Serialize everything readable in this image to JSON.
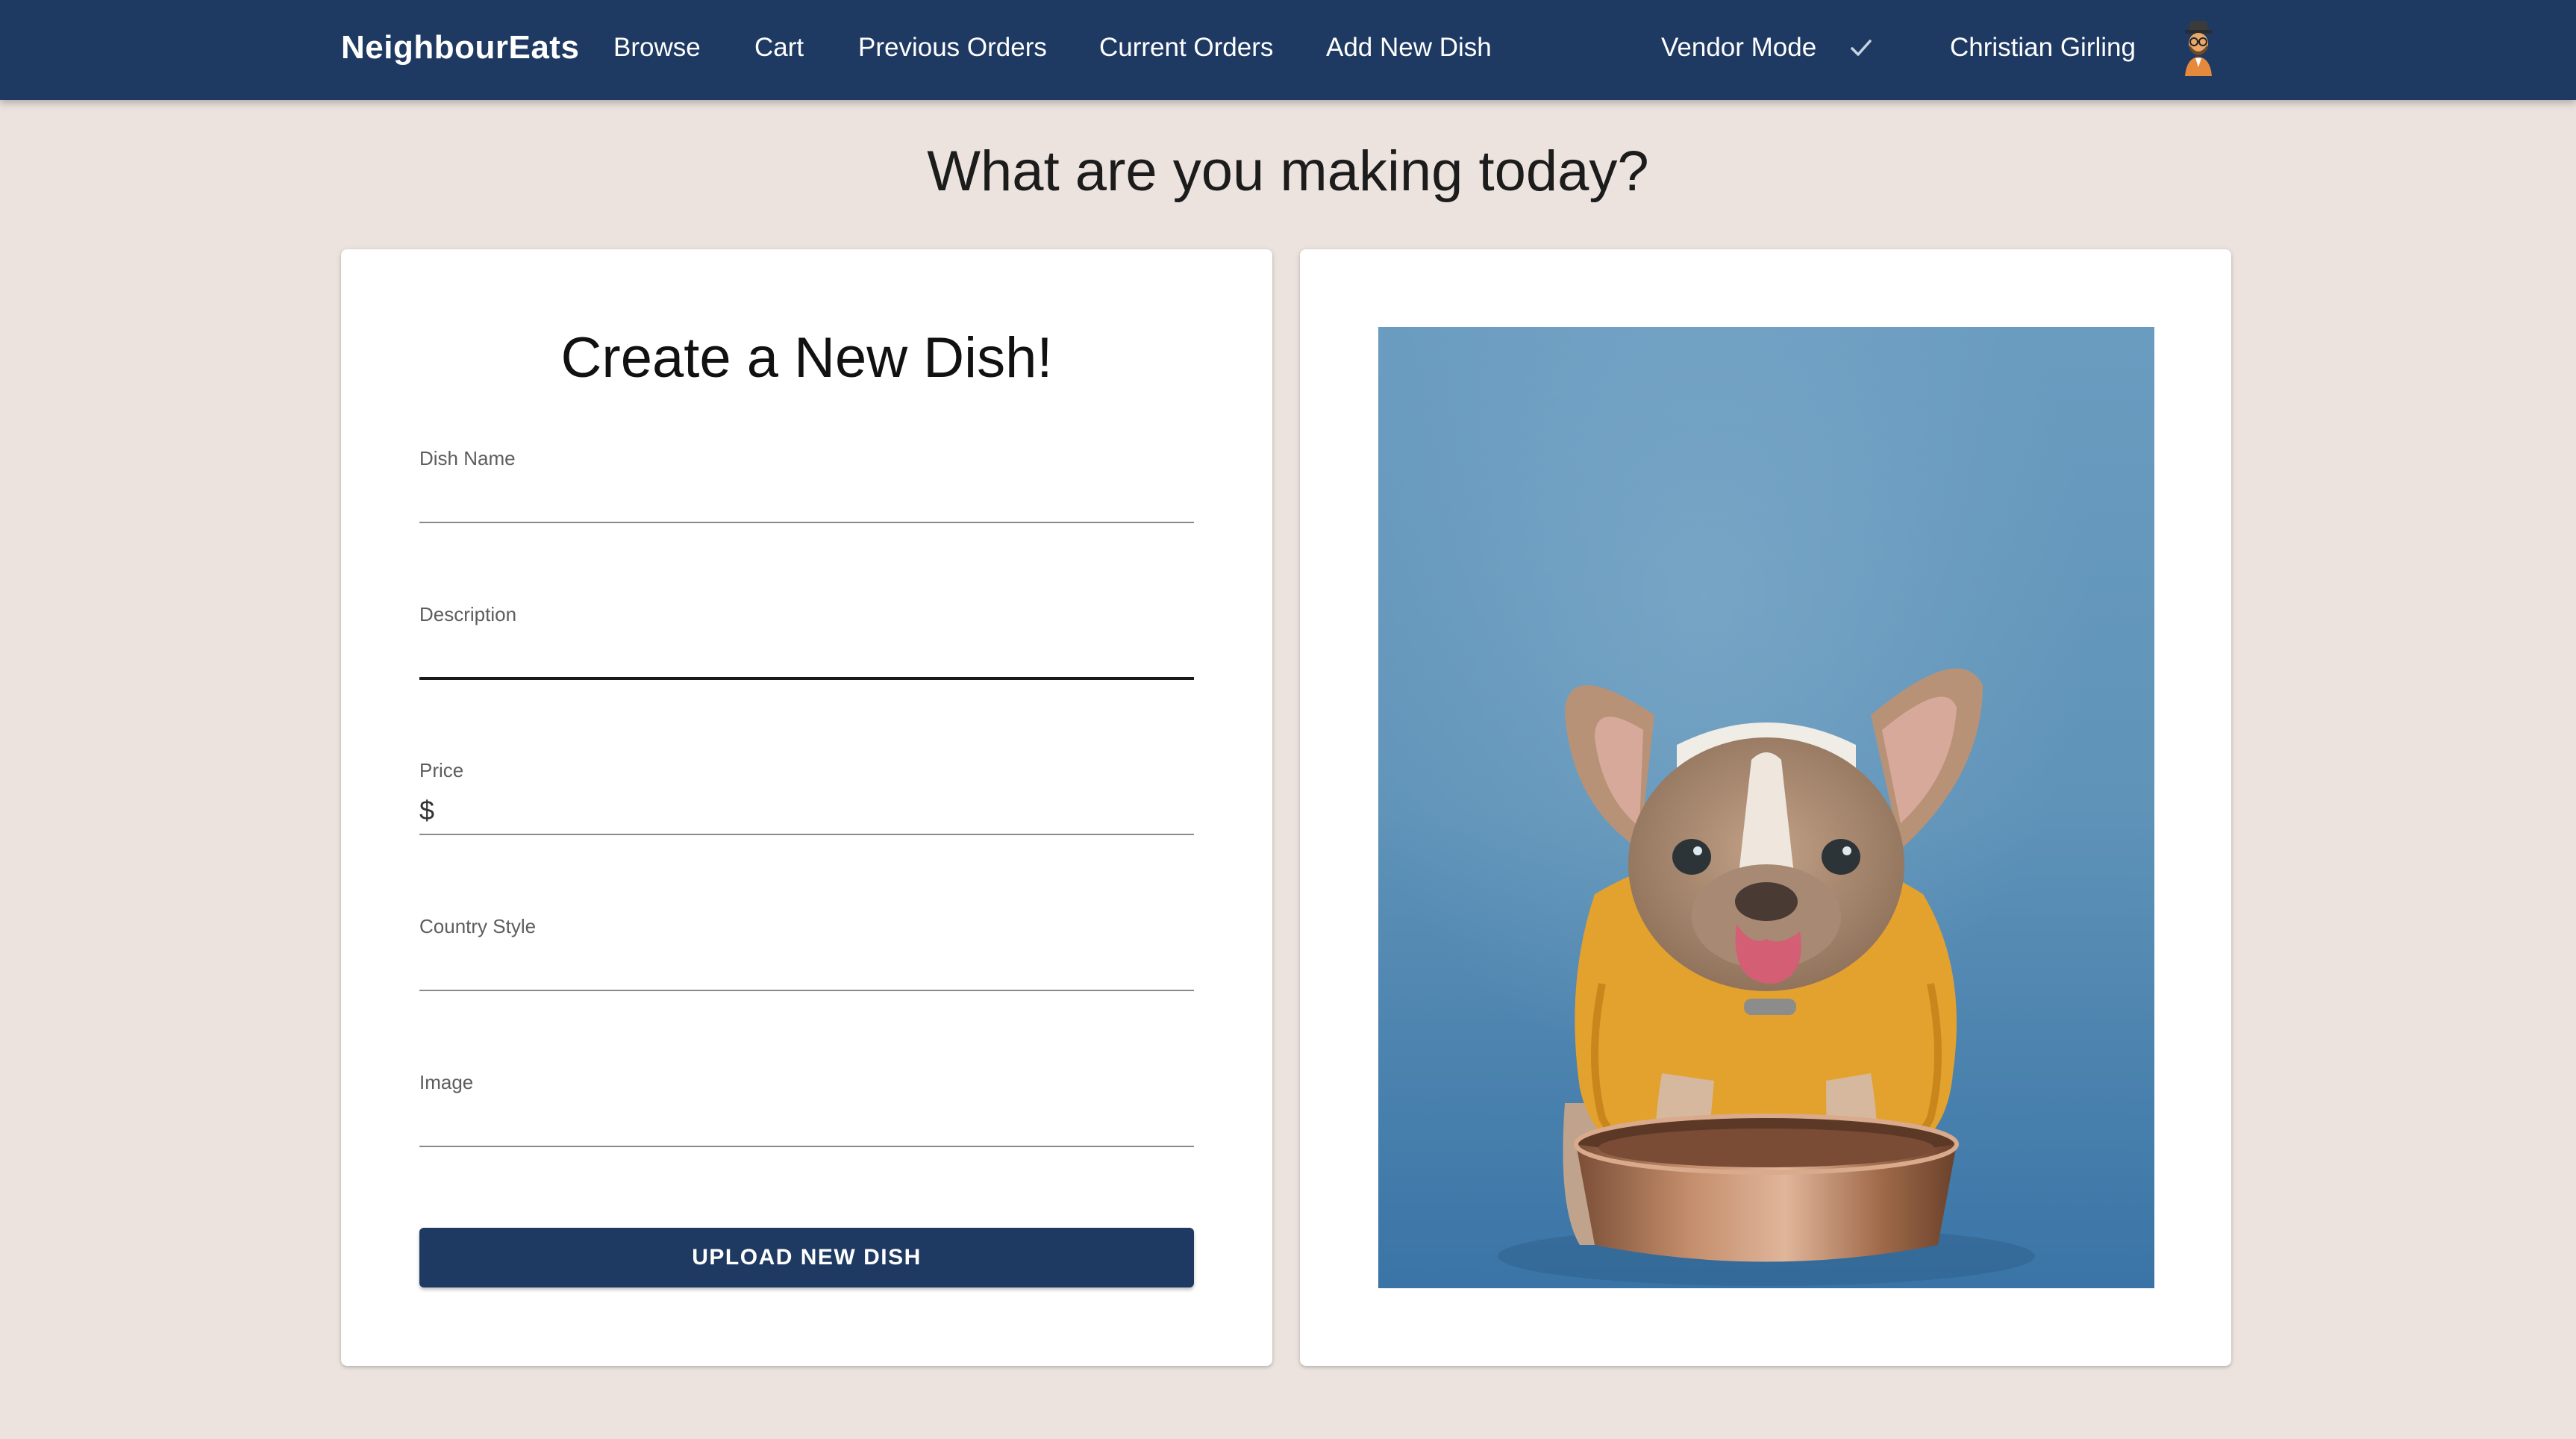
{
  "navbar": {
    "brand": "NeighbourEats",
    "links": [
      "Browse",
      "Cart",
      "Previous Orders",
      "Current Orders",
      "Add New Dish"
    ],
    "vendor_mode_label": "Vendor Mode",
    "vendor_mode_checked": true,
    "user_name": "Christian Girling",
    "check_icon": "check-icon",
    "avatar_icon": "avatar"
  },
  "page": {
    "title": "What are you making today?"
  },
  "form": {
    "title": "Create a New Dish!",
    "fields": {
      "dish_name": {
        "label": "Dish Name",
        "value": ""
      },
      "description": {
        "label": "Description",
        "value": ""
      },
      "price": {
        "label": "Price",
        "prefix": "$",
        "value": ""
      },
      "country_style": {
        "label": "Country Style",
        "value": ""
      },
      "image": {
        "label": "Image",
        "value": ""
      }
    },
    "submit_label": "UPLOAD NEW DISH"
  },
  "preview": {
    "image_subject": "french-bulldog-licking-lips-with-bowl"
  },
  "colors": {
    "navbar": "#1f3a62",
    "page_background": "#ece3de",
    "card_background": "#ffffff",
    "button": "#1f3a62",
    "photo_background": "#5e91b5",
    "sweater": "#e0a12c"
  }
}
